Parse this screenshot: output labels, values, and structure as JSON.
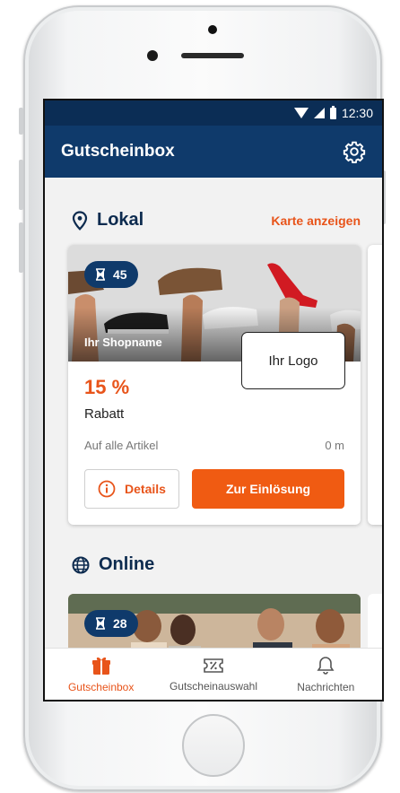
{
  "status_bar": {
    "time": "12:30"
  },
  "app_bar": {
    "title": "Gutscheinbox"
  },
  "local_section": {
    "title": "Lokal",
    "map_link": "Karte anzeigen"
  },
  "local_card": {
    "timer_count": "45",
    "shop_name": "Ihr Shopname",
    "logo_text": "Ihr Logo",
    "discount": "15 %",
    "discount_label": "Rabatt",
    "scope": "Auf alle Artikel",
    "distance": "0 m",
    "details_label": "Details",
    "redeem_label": "Zur Einlösung"
  },
  "online_section": {
    "title": "Online"
  },
  "online_card": {
    "timer_count": "28"
  },
  "bottom_nav": {
    "items": [
      {
        "label": "Gutscheinbox",
        "icon": "gift-icon",
        "active": true
      },
      {
        "label": "Gutscheinauswahl",
        "icon": "coupon-icon",
        "active": false
      },
      {
        "label": "Nachrichten",
        "icon": "bell-icon",
        "active": false
      }
    ]
  },
  "colors": {
    "primary": "#0f3a6b",
    "status_bar": "#0b2d55",
    "accent": "#e8541a",
    "button": "#f05b12"
  }
}
